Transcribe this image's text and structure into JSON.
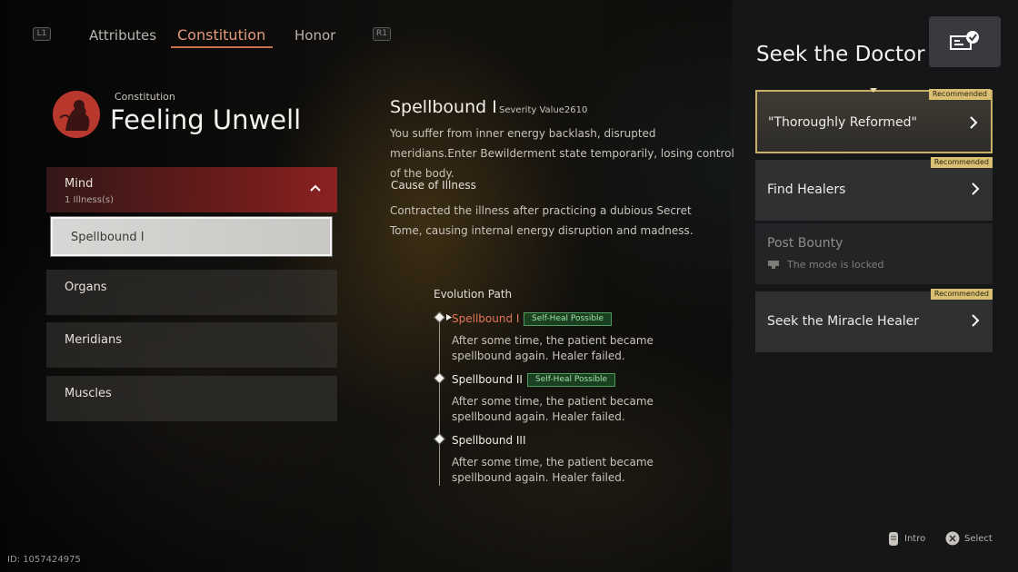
{
  "tabs": {
    "left_key": "L1",
    "right_key": "R1",
    "items": [
      {
        "label": "Attributes"
      },
      {
        "label": "Constitution"
      },
      {
        "label": "Honor"
      }
    ],
    "active_index": 1
  },
  "header": {
    "category": "Constitution",
    "title": "Feeling Unwell"
  },
  "left_list": {
    "mind": {
      "label": "Mind",
      "sub": "1 Illness(s)"
    },
    "selected_illness": "Spellbound I",
    "organs": "Organs",
    "meridians": "Meridians",
    "muscles": "Muscles"
  },
  "detail": {
    "title": "Spellbound I",
    "severity": "Severity Value2610",
    "description": "You suffer from inner energy backlash, disrupted meridians.Enter Bewilderment state temporarily, losing control of the body.",
    "cause_title": "Cause of Illness",
    "cause_text": "Contracted the illness after practicing a dubious Secret Tome, causing internal energy disruption and madness."
  },
  "evolution": {
    "title": "Evolution Path",
    "steps": [
      {
        "name": "Spellbound I",
        "tag": "Self-Heal Possible",
        "text": "After some time, the patient became spellbound again. Healer failed."
      },
      {
        "name": "Spellbound II",
        "tag": "Self-Heal Possible",
        "text": "After some time, the patient became spellbound again. Healer failed."
      },
      {
        "name": "Spellbound III",
        "tag": "",
        "text": "After some time, the patient became spellbound again. Healer failed."
      }
    ]
  },
  "right_panel": {
    "title": "Seek the Doctor",
    "options": [
      {
        "label": "\"Thoroughly Reformed\"",
        "badge": "Recommended"
      },
      {
        "label": "Find Healers",
        "badge": "Recommended"
      },
      {
        "label": "Post Bounty",
        "badge": "",
        "note": "The mode is locked"
      },
      {
        "label": "Seek the Miracle Healer",
        "badge": "Recommended"
      }
    ]
  },
  "footer": {
    "id": "ID: 1057424975",
    "intro": "Intro",
    "select": "Select"
  },
  "colors": {
    "active_tab": "#e39a7a",
    "current_step": "#e4765c",
    "highlight_border": "#c9b066",
    "badge": "#d9bf71",
    "mind_red": "#96231f"
  }
}
